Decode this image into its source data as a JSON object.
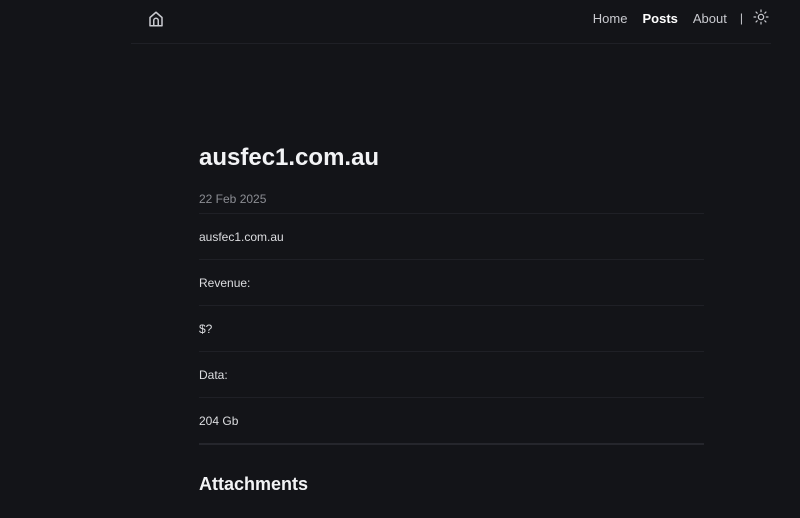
{
  "header": {
    "home_icon": "home-icon",
    "nav": {
      "home": "Home",
      "posts": "Posts",
      "about": "About",
      "separator": "|"
    },
    "theme_icon": "sun-icon"
  },
  "post": {
    "title": "ausfec1.com.au",
    "date": "22 Feb 2025",
    "paragraphs": [
      "ausfec1.com.au",
      "Revenue:",
      "$?",
      "Data:",
      "204 Gb"
    ],
    "attachments_heading": "Attachments"
  },
  "colors": {
    "background": "#131418",
    "text": "#dcdde0",
    "muted": "#8b8d93",
    "heading": "#f2f3f5",
    "divider": "#1f2026"
  }
}
